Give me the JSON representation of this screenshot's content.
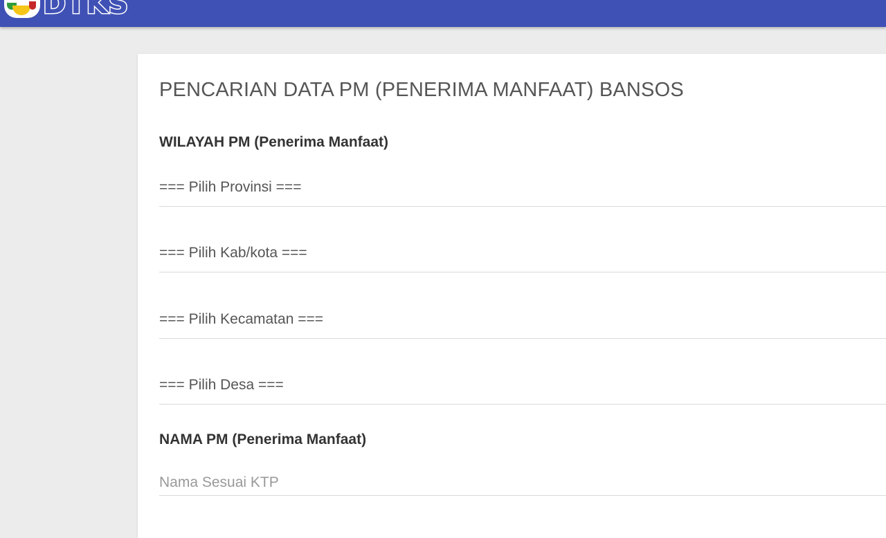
{
  "header": {
    "logo_text": "DTKS",
    "logo_icon": "dtks-logo-icon",
    "background_color": "#3f51b5"
  },
  "form": {
    "title": "PENCARIAN DATA PM (PENERIMA MANFAAT) BANSOS",
    "wilayah_label": "WILAYAH PM (Penerima Manfaat)",
    "selects": {
      "provinsi": "=== Pilih Provinsi ===",
      "kabkota": "=== Pilih Kab/kota ===",
      "kecamatan": "=== Pilih Kecamatan ===",
      "desa": "=== Pilih Desa ==="
    },
    "nama_label": "NAMA PM (Penerima Manfaat)",
    "nama_placeholder": "Nama Sesuai KTP",
    "nama_value": ""
  }
}
